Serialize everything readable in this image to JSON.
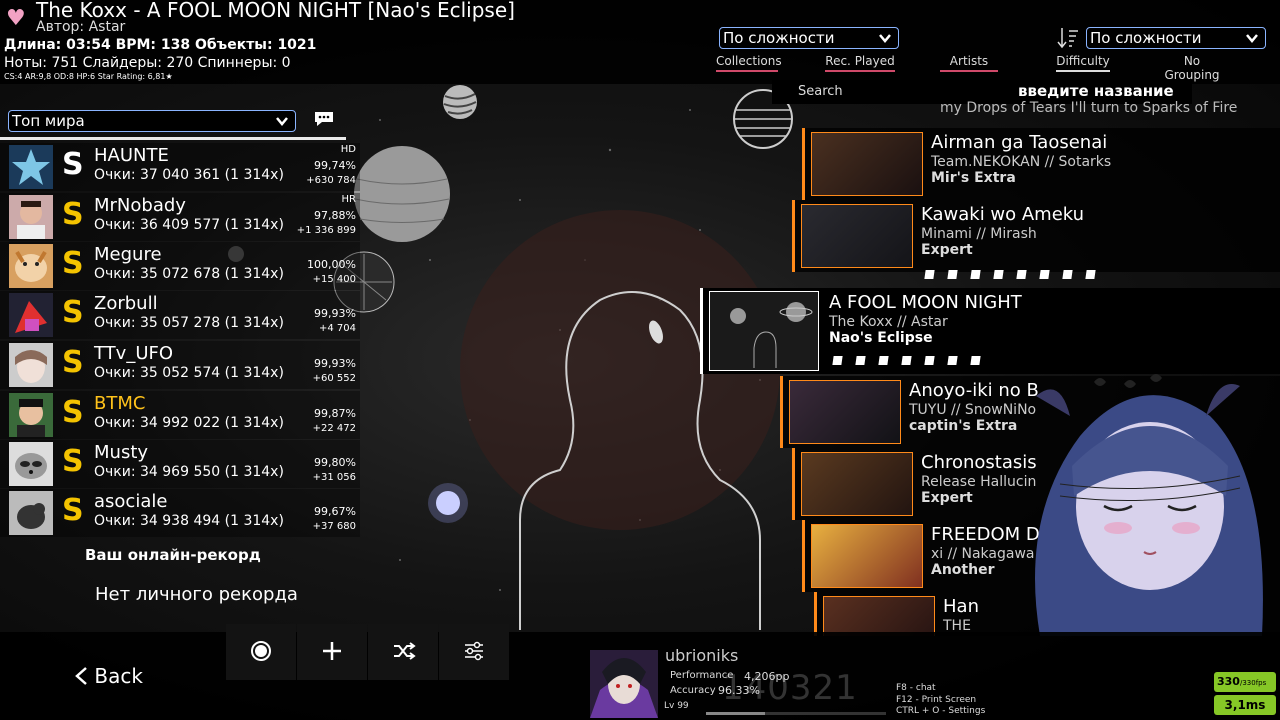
{
  "song": {
    "title": "The Koxx - A FOOL MOON NIGHT [Nao's Eclipse]",
    "author": "Автор: Astar",
    "stats_line1": "Длина: 03:54 BPM: 138 Объекты: 1021",
    "stats_line2": "Ноты: 751 Слайдеры: 270 Спиннеры: 0",
    "stats_line3": "CS:4 AR:9,8 OD:8 HP:6 Star Rating: 6,81★"
  },
  "toolbar": {
    "sort_select": "По сложности",
    "group_select": "По сложности",
    "tabs": [
      "Collections",
      "Rec. Played",
      "Artists",
      "Difficulty",
      "No Grouping"
    ],
    "search_label": "Search",
    "search_hint": "введите название"
  },
  "leaderboard": {
    "scope": "Топ мира",
    "entries": [
      {
        "rank": "S",
        "name": "HAUNTE",
        "score": "Очки: 37 040 361 (1 314x)",
        "mods": "HD",
        "acc": "99,74%",
        "pp": "+630 784"
      },
      {
        "rank": "S",
        "name": "MrNobady",
        "score": "Очки: 36 409 577 (1 314x)",
        "mods": "HR",
        "acc": "97,88%",
        "pp": "+1 336 899"
      },
      {
        "rank": "S",
        "name": "Megure",
        "score": "Очки: 35 072 678 (1 314x)",
        "mods": "",
        "acc": "100,00%",
        "pp": "+15 400"
      },
      {
        "rank": "S",
        "name": "Zorbull",
        "score": "Очки: 35 057 278 (1 314x)",
        "mods": "",
        "acc": "99,93%",
        "pp": "+4 704"
      },
      {
        "rank": "S",
        "name": "TTv_UFO",
        "score": "Очки: 35 052 574 (1 314x)",
        "mods": "",
        "acc": "99,93%",
        "pp": "+60 552"
      },
      {
        "rank": "S",
        "name": "BTMC",
        "score": "Очки: 34 992 022 (1 314x)",
        "mods": "",
        "acc": "99,87%",
        "pp": "+22 472"
      },
      {
        "rank": "S",
        "name": "Musty",
        "score": "Очки: 34 969 550 (1 314x)",
        "mods": "",
        "acc": "99,80%",
        "pp": "+31 056"
      },
      {
        "rank": "S",
        "name": "asociale",
        "score": "Очки: 34 938 494 (1 314x)",
        "mods": "",
        "acc": "99,67%",
        "pp": "+37 680"
      }
    ],
    "online_record": "Ваш онлайн-рекорд",
    "no_personal": "Нет личного рекорда"
  },
  "songlist": {
    "partial_top": "my Drops of Tears I'll turn to Sparks of Fire",
    "items": [
      {
        "title": "Airman ga Taosenai",
        "artist": "Team.NEKOKAN // Sotarks",
        "diff": "Mir's Extra"
      },
      {
        "title": "Kawaki wo Ameku",
        "artist": "Minami // Mirash",
        "diff": "Expert"
      },
      {
        "title": "A FOOL MOON NIGHT",
        "artist": "The Koxx // Astar",
        "diff": "Nao's Eclipse"
      },
      {
        "title": "Anoyo-iki no B",
        "artist": "TUYU // SnowNiNo",
        "diff": "captin's Extra"
      },
      {
        "title": "Chronostasis",
        "artist": "Release Hallucin",
        "diff": "Expert"
      },
      {
        "title": "FREEDOM D",
        "artist": "xi // Nakagawa",
        "diff": "Another"
      },
      {
        "title": "Han",
        "artist": "THE",
        "diff": ""
      }
    ]
  },
  "bottom": {
    "back": "Back",
    "user": {
      "name": "ubrioniks",
      "performance_label": "Performance",
      "performance": "4,206pp",
      "accuracy_label": "Accuracy",
      "accuracy": "96.33%",
      "level": "Lv 99",
      "score": "140321",
      "level_progress": 0.33
    },
    "hints": [
      "F8 - chat",
      "F12 - Print Screen",
      "CTRL + O - Settings"
    ],
    "fps": "330",
    "fps_sub": "/330fps",
    "ms": "3,1ms"
  },
  "colors": {
    "accent": "#8ab4ff",
    "gold": "#f4c300",
    "orange": "#ff8a1a",
    "pink_underline": "#d04a6a",
    "fps_green": "#86c726"
  }
}
